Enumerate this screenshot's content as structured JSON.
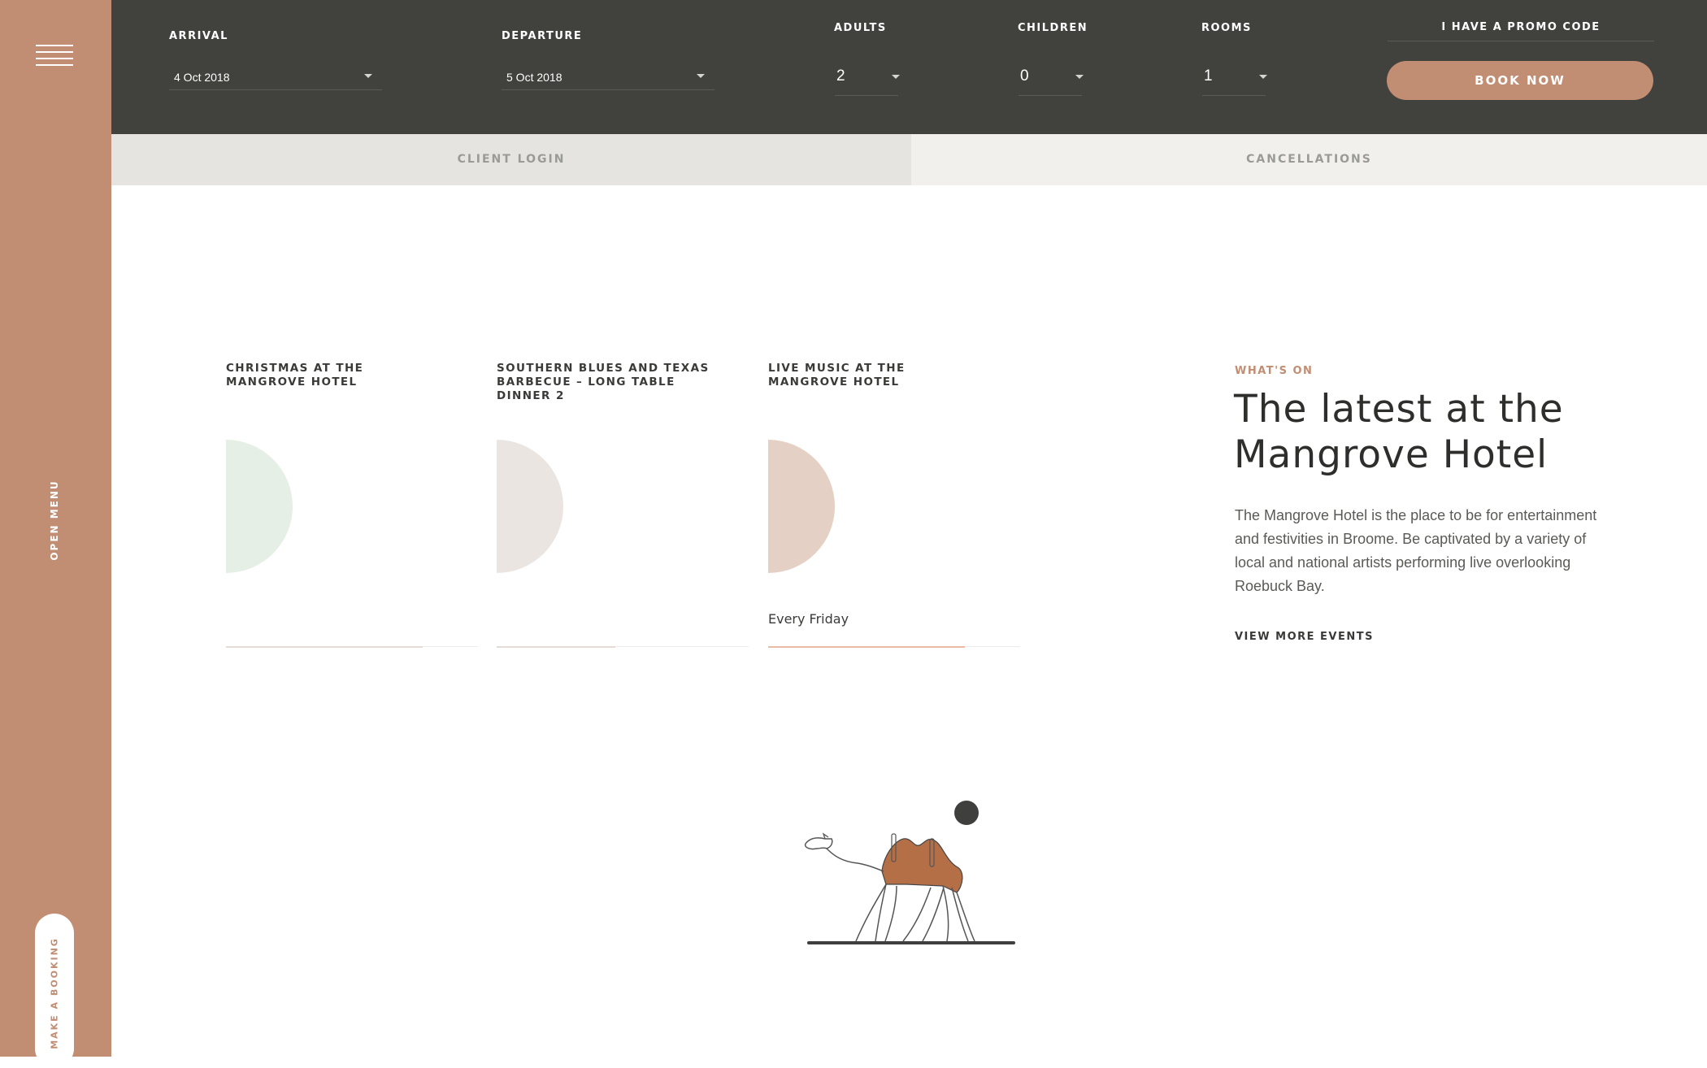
{
  "colors": {
    "accent": "#c18d73",
    "dark_bar": "#41413e",
    "mint": "#e5efe5",
    "greige": "#ebe5e2",
    "blush": "#e5d0c5"
  },
  "sidebar": {
    "menu_icon": "hamburger-icon",
    "open_menu_label": "OPEN MENU",
    "booking_label": "MAKE A BOOKING"
  },
  "booking": {
    "arrival_label": "ARRIVAL",
    "arrival_value": "4 Oct 2018",
    "departure_label": "DEPARTURE",
    "departure_value": "5 Oct 2018",
    "adults_label": "ADULTS",
    "adults_value": "2",
    "children_label": "CHILDREN",
    "children_value": "0",
    "rooms_label": "ROOMS",
    "rooms_value": "1",
    "promo_label": "I HAVE A PROMO CODE",
    "book_label": "BOOK NOW"
  },
  "tabs": [
    {
      "label": "CLIENT LOGIN"
    },
    {
      "label": "CANCELLATIONS"
    }
  ],
  "events": [
    {
      "title": "CHRISTMAS AT THE MANGROVE HOTEL",
      "date": "",
      "color": "#e5efe5",
      "progress": 0.78,
      "progress_color": "#e5dcd8"
    },
    {
      "title": "SOUTHERN BLUES AND TEXAS BARBECUE – LONG TABLE DINNER 2",
      "date": "",
      "color": "#ebe5e2",
      "progress": 0.47,
      "progress_color": "#e5dcd8"
    },
    {
      "title": "LIVE MUSIC AT THE MANGROVE HOTEL",
      "date": "Every Friday",
      "color": "#e5d0c5",
      "progress": 0.78,
      "progress_color": "#e8bba5"
    }
  ],
  "whats_on": {
    "eyebrow": "WHAT'S ON",
    "headline": "The latest at the Mangrove Hotel",
    "description": "The Mangrove Hotel is the place to be for entertainment and festivities in Broome. Be captivated by a variety of local and national artists performing live overlooking Roebuck Bay.",
    "link_label": "VIEW MORE EVENTS"
  },
  "illustration": {
    "icon": "camel-illustration"
  }
}
